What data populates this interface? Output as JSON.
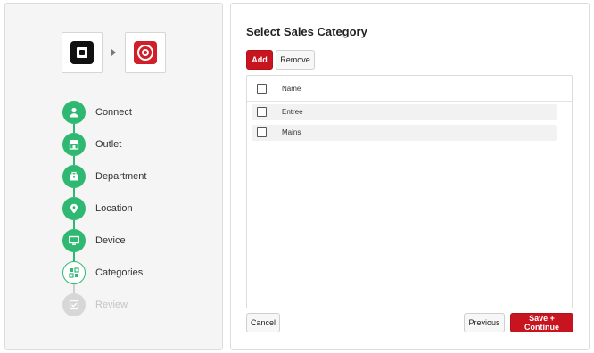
{
  "integration": {
    "source_icon": "square-logo-icon",
    "target_icon": "target-logo-icon"
  },
  "steps": [
    {
      "label": "Connect",
      "icon": "user-icon",
      "state": "done"
    },
    {
      "label": "Outlet",
      "icon": "store-icon",
      "state": "done"
    },
    {
      "label": "Department",
      "icon": "briefcase-icon",
      "state": "done"
    },
    {
      "label": "Location",
      "icon": "map-pin-icon",
      "state": "done"
    },
    {
      "label": "Device",
      "icon": "monitor-icon",
      "state": "done"
    },
    {
      "label": "Categories",
      "icon": "grid-icon",
      "state": "current"
    },
    {
      "label": "Review",
      "icon": "check-square-icon",
      "state": "pending"
    }
  ],
  "main": {
    "title": "Select Sales Category",
    "add_label": "Add",
    "remove_label": "Remove",
    "table": {
      "column_name": "Name",
      "rows": [
        "Entree",
        "Mains"
      ]
    },
    "cancel_label": "Cancel",
    "previous_label": "Previous",
    "save_label": "Save + Continue"
  },
  "colors": {
    "accent_red": "#c8141f",
    "step_green": "#2eb872",
    "pending_gray": "#d7d7d7"
  }
}
